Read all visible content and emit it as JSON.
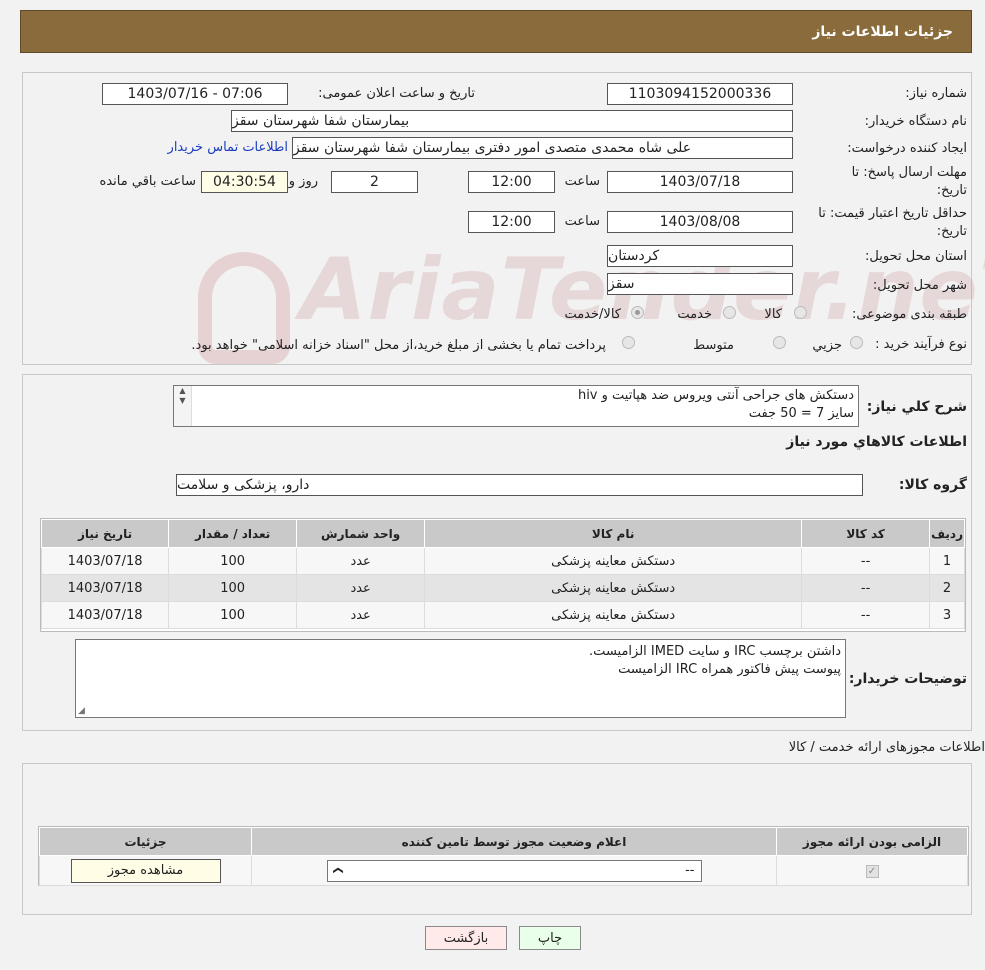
{
  "header": {
    "title": "جزئیات اطلاعات نیاز"
  },
  "info": {
    "need_number_label": "شماره نیاز:",
    "need_number": "1103094152000336",
    "announce_label": "تاریخ و ساعت اعلان عمومی:",
    "announce_value": "1403/07/16 - 07:06",
    "buyer_org_label": "نام دستگاه خریدار:",
    "buyer_org": "بیمارستان شفا شهرستان سقز",
    "requester_label": "ایجاد کننده درخواست:",
    "requester": "علی شاه محمدی متصدی امور دفتری بیمارستان شفا شهرستان سقز",
    "contact_link": "اطلاعات تماس خریدار",
    "deadline_label_1": "مهلت ارسال پاسخ: تا",
    "deadline_label_2": "تاریخ:",
    "deadline_date": "1403/07/18",
    "time_label": "ساعت",
    "deadline_time": "12:00",
    "days_value": "2",
    "days_label": "روز و",
    "remaining_value": "04:30:54",
    "remaining_label": "ساعت باقي مانده",
    "validity_label_1": "حداقل تاریخ اعتبار قیمت: تا",
    "validity_label_2": "تاریخ:",
    "validity_date": "1403/08/08",
    "validity_time": "12:00",
    "province_label": "استان محل تحویل:",
    "province": "کردستان",
    "city_label": "شهر محل تحویل:",
    "city": "سقز",
    "category_label": "طبقه بندی موضوعی:",
    "category_options": [
      "کالا",
      "خدمت",
      "کالا/خدمت"
    ],
    "purchase_label": "نوع فرآیند خرید :",
    "purchase_options": [
      "جزیي",
      "متوسط"
    ],
    "purchase_note": "پرداخت تمام یا بخشی از مبلغ خرید،از محل \"اسناد خزانه اسلامی\" خواهد بود."
  },
  "details": {
    "general_label": "شرح کلي نیاز:",
    "general_line1": "دستکش های جراحی آنتی ویروس ضد هپاتیت و  hiv",
    "general_line2": "سایز 7 = 50 جفت",
    "goods_info_title": "اطلاعات کالاهاي مورد نیاز",
    "group_label": "گروه کالا:",
    "group_value": "دارو، پزشکی و سلامت",
    "table_headers": [
      "ردیف",
      "کد کالا",
      "نام کالا",
      "واحد شمارش",
      "تعداد / مقدار",
      "تاریخ نیاز"
    ],
    "rows": [
      [
        "1",
        "--",
        "دستکش معاینه پزشکی",
        "عدد",
        "100",
        "1403/07/18"
      ],
      [
        "2",
        "--",
        "دستکش معاینه پزشکی",
        "عدد",
        "100",
        "1403/07/18"
      ],
      [
        "3",
        "--",
        "دستکش معاینه پزشکی",
        "عدد",
        "100",
        "1403/07/18"
      ]
    ],
    "buyer_notes_label": "توضیحات خریدار:",
    "buyer_notes_line1": "داشتن برچسب IRC  و سایت  IMED  الزامیست.",
    "buyer_notes_line2": "پیوست پیش فاکتور همراه IRC  الزامیست"
  },
  "licenses": {
    "title": "اطلاعات مجوزهای ارائه خدمت / کالا",
    "headers": [
      "الزامی بودن ارائه مجوز",
      "اعلام وضعیت مجوز توسط تامین کننده",
      "جزئیات"
    ],
    "select_value": "--",
    "view_button": "مشاهده مجوز"
  },
  "actions": {
    "print": "چاپ",
    "back": "بازگشت"
  },
  "watermark": "AriaTender.neT"
}
